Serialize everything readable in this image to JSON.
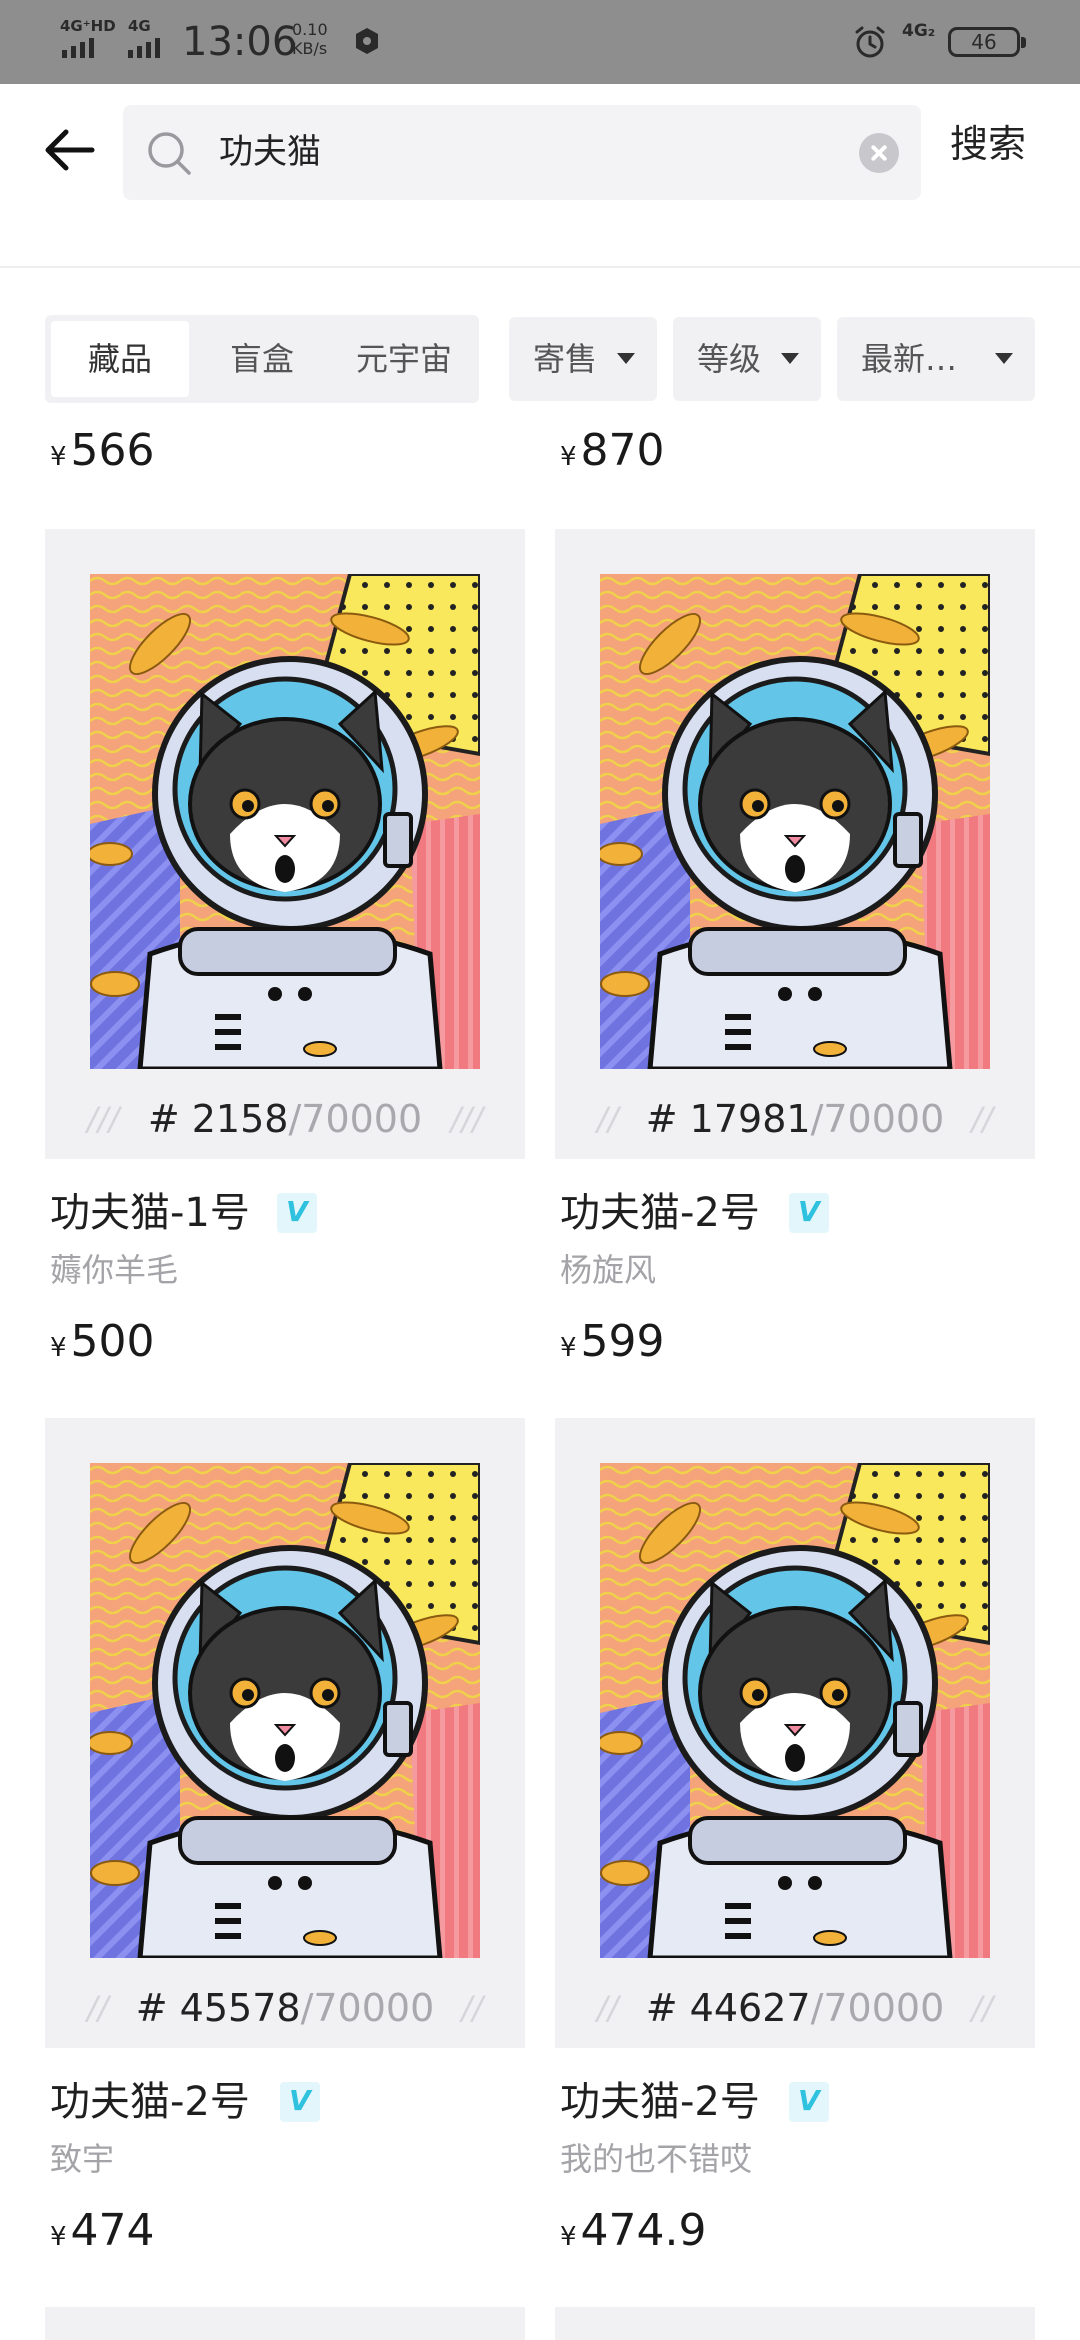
{
  "status_bar": {
    "net1": "4G⁺HD",
    "net2": "4G",
    "time": "13:06",
    "speed_value": "0.10",
    "speed_unit": "KB/s",
    "net3": "4G₂",
    "battery": "46"
  },
  "search": {
    "query": "功夫猫",
    "button_label": "搜索"
  },
  "filters": {
    "tabs": [
      {
        "label": "藏品",
        "active": true
      },
      {
        "label": "盲盒",
        "active": false
      },
      {
        "label": "元宇宙",
        "active": false
      }
    ],
    "dropdowns": [
      {
        "label": "寄售"
      },
      {
        "label": "等级"
      },
      {
        "label": "最新…"
      }
    ]
  },
  "top_prices": [
    "566",
    "870"
  ],
  "currency_symbol": "¥",
  "items": [
    {
      "serial": "# 2158",
      "total": "/70000",
      "title": "功夫猫-1号",
      "verified": "V",
      "seller": "薅你羊毛",
      "price": "500"
    },
    {
      "serial": "# 17981",
      "total": "/70000",
      "title": "功夫猫-2号",
      "verified": "V",
      "seller": "杨旋风",
      "price": "599"
    },
    {
      "serial": "# 45578",
      "total": "/70000",
      "title": "功夫猫-2号",
      "verified": "V",
      "seller": "致宇",
      "price": "474"
    },
    {
      "serial": "# 44627",
      "total": "/70000",
      "title": "功夫猫-2号",
      "verified": "V",
      "seller": "我的也不错哎",
      "price": "474.9"
    }
  ],
  "colors": {
    "accent_verified": "#2fc2de",
    "card_bg": "#f1f1f4",
    "status_bar_bg": "#8e8e8e"
  }
}
